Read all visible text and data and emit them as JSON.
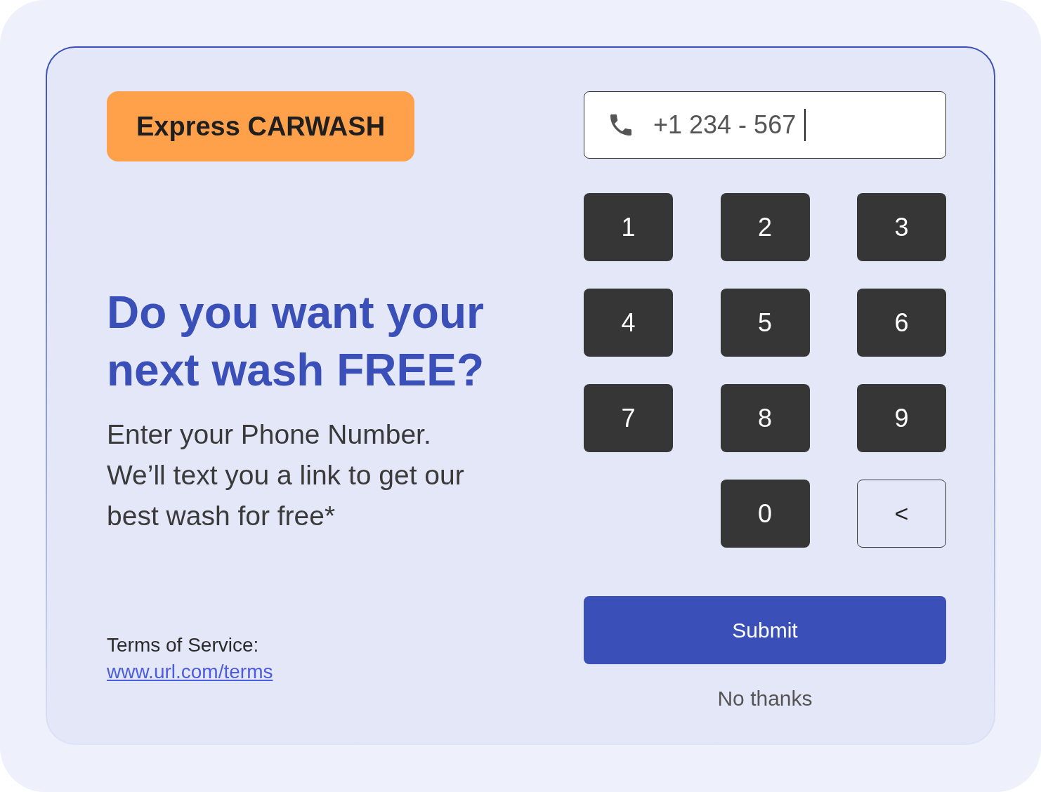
{
  "badge": {
    "text": "Express CARWASH"
  },
  "heading": [
    "Do you want your",
    "next wash FREE?"
  ],
  "description": [
    "Enter your Phone Number.",
    "We’ll text you a link to get our",
    "best wash for free*"
  ],
  "terms": {
    "label": "Terms of Service:",
    "link": "www.url.com/terms"
  },
  "phone_field": {
    "value": "+1 234 - 567",
    "focused": true
  },
  "keypad": [
    {
      "keys": [
        {
          "kind": "digit",
          "label": "1"
        },
        {
          "kind": "digit",
          "label": "2"
        },
        {
          "kind": "digit",
          "label": "3"
        }
      ]
    },
    {
      "keys": [
        {
          "kind": "digit",
          "label": "4"
        },
        {
          "kind": "digit",
          "label": "5"
        },
        {
          "kind": "digit",
          "label": "6"
        }
      ]
    },
    {
      "keys": [
        {
          "kind": "digit",
          "label": "7"
        },
        {
          "kind": "digit",
          "label": "8"
        },
        {
          "kind": "digit",
          "label": "9"
        }
      ]
    },
    {
      "keys": [
        {
          "kind": "digit",
          "label": "0"
        },
        {
          "kind": "backspace",
          "label": "<"
        }
      ]
    }
  ],
  "submit": "Submit",
  "dismiss": "No thanks"
}
